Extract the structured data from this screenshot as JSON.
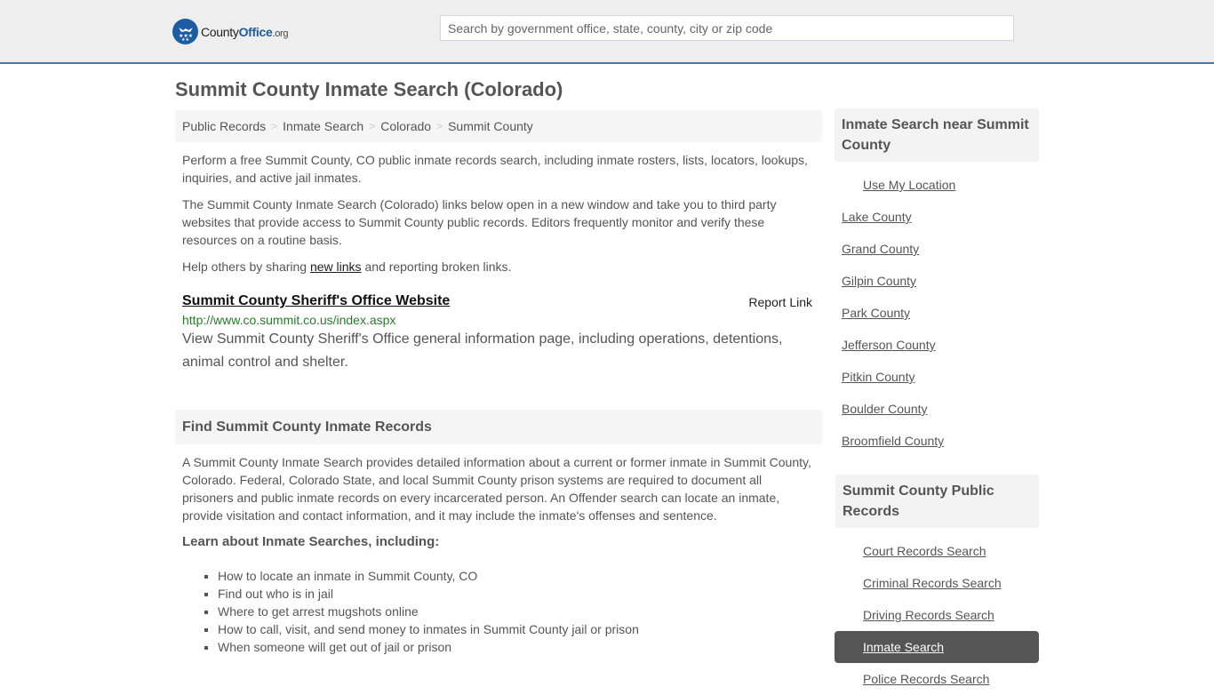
{
  "header": {
    "logo": {
      "name": "County",
      "name_accent": "Office",
      "tld": ".org",
      "icon": "eagle-stars-icon"
    },
    "search": {
      "placeholder": "Search by government office, state, county, city or zip code",
      "value": ""
    }
  },
  "page": {
    "title": "Summit County Inmate Search (Colorado)"
  },
  "breadcrumb": [
    {
      "label": "Public Records"
    },
    {
      "label": "Inmate Search"
    },
    {
      "label": "Colorado"
    },
    {
      "label": "Summit County"
    }
  ],
  "breadcrumb_separator": ">",
  "intro": {
    "p1": "Perform a free Summit County, CO public inmate records search, including inmate rosters, lists, locators, lookups, inquiries, and active jail inmates.",
    "p2": "The Summit County Inmate Search (Colorado) links below open in a new window and take you to third party websites that provide access to Summit County public records. Editors frequently monitor and verify these resources on a routine basis.",
    "p3_before": "Help others by sharing ",
    "p3_link": "new links",
    "p3_after": " and reporting broken links."
  },
  "listing": {
    "title": "Summit County Sheriff's Office Website",
    "report_label": "Report Link",
    "url": "http://www.co.summit.co.us/index.aspx",
    "description": "View Summit County Sheriff's Office general information page, including operations, detentions, animal control and shelter."
  },
  "find_section": {
    "heading": "Find Summit County Inmate Records",
    "body": "A Summit County Inmate Search provides detailed information about a current or former inmate in Summit County, Colorado. Federal, Colorado State, and local Summit County prison systems are required to document all prisoners and public inmate records on every incarcerated person. An Offender search can locate an inmate, provide visitation and contact information, and it may include the inmate's offenses and sentence.",
    "learn_heading": "Learn about Inmate Searches, including:",
    "bullets": [
      "How to locate an inmate in Summit County, CO",
      "Find out who is in jail",
      "Where to get arrest mugshots online",
      "How to call, visit, and send money to inmates in Summit County jail or prison",
      "When someone will get out of jail or prison"
    ]
  },
  "sidebar": {
    "nearby": {
      "heading": "Inmate Search near Summit County",
      "use_location": "Use My Location",
      "counties": [
        "Lake County",
        "Grand County",
        "Gilpin County",
        "Park County",
        "Jefferson County",
        "Pitkin County",
        "Boulder County",
        "Broomfield County"
      ]
    },
    "records": {
      "heading": "Summit County Public Records",
      "items": [
        {
          "label": "Court Records Search",
          "active": false
        },
        {
          "label": "Criminal Records Search",
          "active": false
        },
        {
          "label": "Driving Records Search",
          "active": false
        },
        {
          "label": "Inmate Search",
          "active": true
        },
        {
          "label": "Police Records Search",
          "active": false
        }
      ]
    }
  },
  "colors": {
    "brand": "#1b5ca3",
    "header_border": "#3a7cb5",
    "url_green": "#2a7a2a",
    "active_bg": "#555555"
  }
}
